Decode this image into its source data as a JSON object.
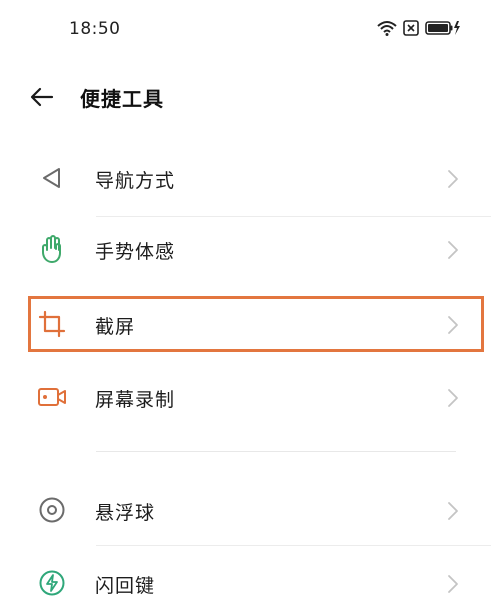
{
  "status_bar": {
    "time": "18:50",
    "icons": [
      "wifi-icon",
      "sim-icon",
      "battery-charging-icon"
    ]
  },
  "header": {
    "back_icon": "arrow-left-icon",
    "title": "便捷工具"
  },
  "items": [
    {
      "label": "导航方式",
      "icon": "navigation-triangle-icon",
      "icon_color": "#6b6b6b"
    },
    {
      "label": "手势体感",
      "icon": "hand-gesture-icon",
      "icon_color": "#3fa96b"
    },
    {
      "label": "截屏",
      "icon": "crop-icon",
      "icon_color": "#e0703a"
    },
    {
      "label": "屏幕录制",
      "icon": "video-record-icon",
      "icon_color": "#e0703a"
    },
    {
      "label": "悬浮球",
      "icon": "floating-ball-icon",
      "icon_color": "#6b6b6b"
    },
    {
      "label": "闪回键",
      "icon": "flashback-icon",
      "icon_color": "#2fa77a"
    }
  ],
  "highlight_color": "#e3763f"
}
